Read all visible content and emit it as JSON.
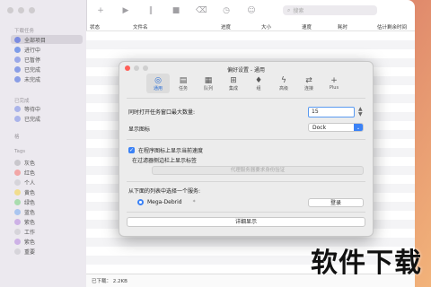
{
  "sidebar": {
    "sections": [
      {
        "title": "下载任务"
      },
      {
        "title": "已完成"
      },
      {
        "title": "格"
      },
      {
        "title": "Tags"
      }
    ],
    "downloads": [
      {
        "label": "全部项目",
        "color": "#7b8be0",
        "active": true
      },
      {
        "label": "进行中",
        "color": "#7e9ce8"
      },
      {
        "label": "已暂停",
        "color": "#9aa8e8"
      },
      {
        "label": "已完成",
        "color": "#8a9ee6"
      },
      {
        "label": "未完成",
        "color": "#8a9ee6"
      }
    ],
    "completed": [
      {
        "label": "等待中",
        "color": "#aab4ea"
      },
      {
        "label": "已完成",
        "color": "#aab4ea"
      }
    ],
    "tags": [
      {
        "label": "灰色",
        "color": "#c9c7cc"
      },
      {
        "label": "红色",
        "color": "#f2a6a6"
      },
      {
        "label": "个人",
        "color": "#d6d4da"
      },
      {
        "label": "黄色",
        "color": "#f1dd8e"
      },
      {
        "label": "绿色",
        "color": "#a9dcae"
      },
      {
        "label": "蓝色",
        "color": "#a9c5f0"
      },
      {
        "label": "紫色",
        "color": "#cdb1e6"
      },
      {
        "label": "工作",
        "color": "#d6d4da"
      },
      {
        "label": "紫色",
        "color": "#cdb1e6"
      },
      {
        "label": "重要",
        "color": "#d6d4da"
      }
    ]
  },
  "toolbar": {
    "search_placeholder": "搜索"
  },
  "table": {
    "columns": [
      "状态",
      "文件名",
      "进度",
      "大小",
      "速度",
      "耗时",
      "估计剩余时间"
    ]
  },
  "statusbar": {
    "text": "已下载： 2.2KB"
  },
  "dialog": {
    "title": "偏好设置 - 通用",
    "tabs": [
      {
        "label": "通用",
        "icon": "gear-icon",
        "glyph": "◎",
        "active": true
      },
      {
        "label": "任务",
        "icon": "document-icon",
        "glyph": "▤"
      },
      {
        "label": "队列",
        "icon": "queue-icon",
        "glyph": "▦"
      },
      {
        "label": "集成",
        "icon": "integration-icon",
        "glyph": "⊞"
      },
      {
        "label": "组",
        "icon": "group-icon",
        "glyph": "♦"
      },
      {
        "label": "高级",
        "icon": "bolt-icon",
        "glyph": "ϟ"
      },
      {
        "label": "连接",
        "icon": "connection-icon",
        "glyph": "⇄"
      },
      {
        "label": "Plus",
        "icon": "plus-icon",
        "glyph": "+"
      }
    ],
    "max_tasks_label": "同时打开任务窗口最大数量:",
    "max_tasks_value": "15",
    "show_icon_label": "显示图标",
    "show_icon_value": "Dock",
    "show_speed_label": "在程序图标上显示当前速度",
    "show_speed_checked": true,
    "show_tags_label": "在过滤器侧边栏上显示标签",
    "show_tags_checked": false,
    "proxy_button": "代理服务器要求身份验证",
    "service_prompt": "从下面的列表中选择一个服务:",
    "service_name": "Mega-Debrid",
    "service_badge": "*",
    "login_button": "登录",
    "detail_button": "详细显示"
  },
  "watermark": "软件下载"
}
